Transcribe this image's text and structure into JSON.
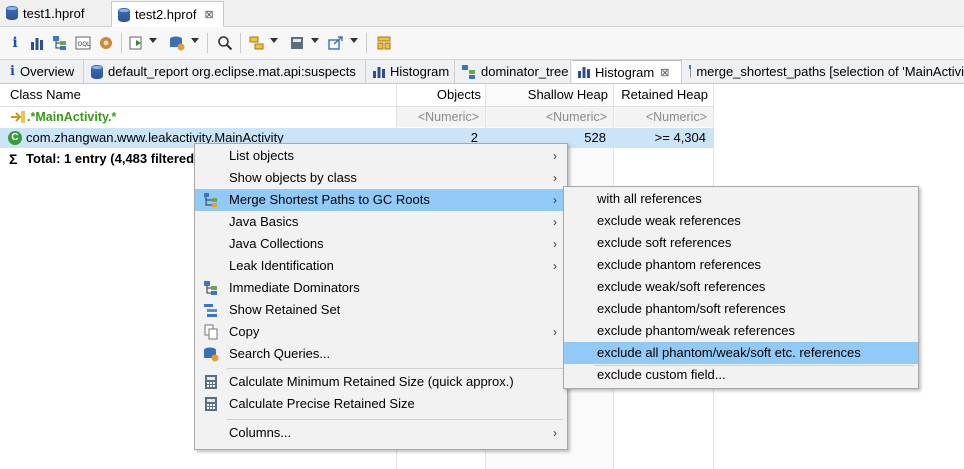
{
  "file_tabs": [
    {
      "label": "test1.hprof"
    },
    {
      "label": "test2.hprof",
      "close": "⊠"
    }
  ],
  "view_tabs": [
    {
      "label": "Overview"
    },
    {
      "label": "default_report  org.eclipse.mat.api:suspects"
    },
    {
      "label": "Histogram"
    },
    {
      "label": "dominator_tree"
    },
    {
      "label": "Histogram",
      "close": "⊠"
    },
    {
      "label": "merge_shortest_paths [selection of 'MainActivi"
    }
  ],
  "table": {
    "columns": [
      "Class Name",
      "Objects",
      "Shallow Heap",
      "Retained Heap"
    ],
    "filter_row": {
      "class_name": ".*MainActivity.*",
      "objects": "<Numeric>",
      "shallow": "<Numeric>",
      "retained": "<Numeric>"
    },
    "rows": [
      {
        "class_name": "com.zhangwan.www.leakactivity.MainActivity",
        "objects": "2",
        "shallow": "528",
        "retained": ">= 4,304"
      }
    ],
    "total": "Total: 1 entry (4,483 filtered"
  },
  "context_menu": {
    "items": [
      {
        "label": "List objects",
        "submenu": true
      },
      {
        "label": "Show objects by class",
        "submenu": true
      },
      {
        "label": "Merge Shortest Paths to GC Roots",
        "submenu": true,
        "highlighted": true
      },
      {
        "label": "Java Basics",
        "submenu": true
      },
      {
        "label": "Java Collections",
        "submenu": true
      },
      {
        "label": "Leak Identification",
        "submenu": true
      },
      {
        "label": "Immediate Dominators"
      },
      {
        "label": "Show Retained Set"
      },
      {
        "label": "Copy",
        "submenu": true
      },
      {
        "label": "Search Queries..."
      },
      {
        "label": "Calculate Minimum Retained Size (quick approx.)"
      },
      {
        "label": "Calculate Precise Retained Size"
      },
      {
        "label": "Columns...",
        "submenu": true
      }
    ],
    "submenu_arrow": "›"
  },
  "submenu": {
    "items": [
      {
        "label": "with all references"
      },
      {
        "label": "exclude weak references"
      },
      {
        "label": "exclude soft references"
      },
      {
        "label": "exclude phantom references"
      },
      {
        "label": "exclude weak/soft references"
      },
      {
        "label": "exclude phantom/soft references"
      },
      {
        "label": "exclude phantom/weak references"
      },
      {
        "label": "exclude all phantom/weak/soft etc. references",
        "highlighted": true
      },
      {
        "label": "exclude custom field..."
      }
    ]
  },
  "icons": {
    "toolbar": [
      "info-icon",
      "histogram-icon",
      "dominator-tree-icon",
      "oql-icon",
      "heap-dump-overview-icon",
      "run-report-icon",
      "query-browser-icon",
      "search-icon",
      "group-by-icon",
      "calculate-retained-icon",
      "export-icon",
      "pin-icon"
    ],
    "colors": {
      "selection": "#cce4f7",
      "menu_highlight": "#91c9f7",
      "filter_text": "#3a9a1a"
    }
  }
}
